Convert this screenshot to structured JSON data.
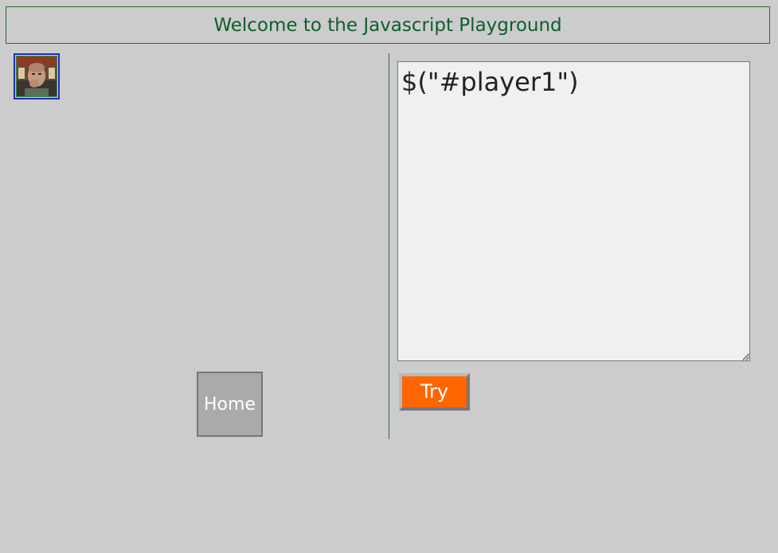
{
  "header": {
    "title": "Welcome to the Javascript Playground"
  },
  "player": {
    "id": "player1",
    "icon": "person-photo-icon"
  },
  "buttons": {
    "home_label": "Home",
    "try_label": "Try"
  },
  "editor": {
    "value": "$(\"#player1\")"
  },
  "colors": {
    "background": "#cccccc",
    "header_text": "#0d5e2b",
    "header_border": "#2e6b2e",
    "player_border": "#1a2fb8",
    "home_button_bg": "#aaaaaa",
    "try_button_bg": "#ff6600",
    "editor_bg": "#f0f0f0"
  }
}
